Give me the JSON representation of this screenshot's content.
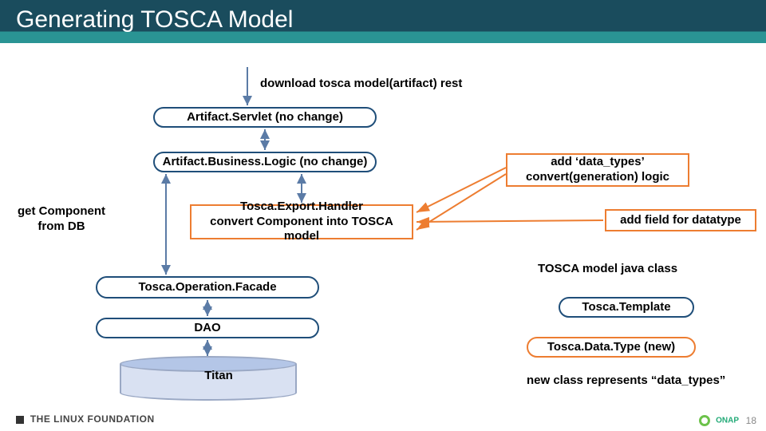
{
  "title": "Generating TOSCA Model",
  "labels": {
    "download": "download tosca model(artifact) rest",
    "getComponent": "get Component from DB",
    "javaClass": "TOSCA model java class",
    "newClass": "new class represents “data_types”",
    "titan": "Titan"
  },
  "boxes": {
    "servlet": "Artifact.Servlet (no change)",
    "businessLogic": "Artifact.Business.Logic (no change)",
    "exportHandler": {
      "line1": "Tosca.Export.Handler",
      "line2": "convert Component into TOSCA model"
    },
    "operationFacade": "Tosca.Operation.Facade",
    "dao": "DAO",
    "addDataTypes": {
      "line1": "add ‘data_types’",
      "line2": "convert(generation) logic"
    },
    "addField": "add field for datatype",
    "toscaTemplate": "Tosca.Template",
    "toscaDataType": "Tosca.Data.Type (new)"
  },
  "footer": {
    "left": "THE LINUX FOUNDATION",
    "right": "ONAP",
    "page": "18"
  }
}
